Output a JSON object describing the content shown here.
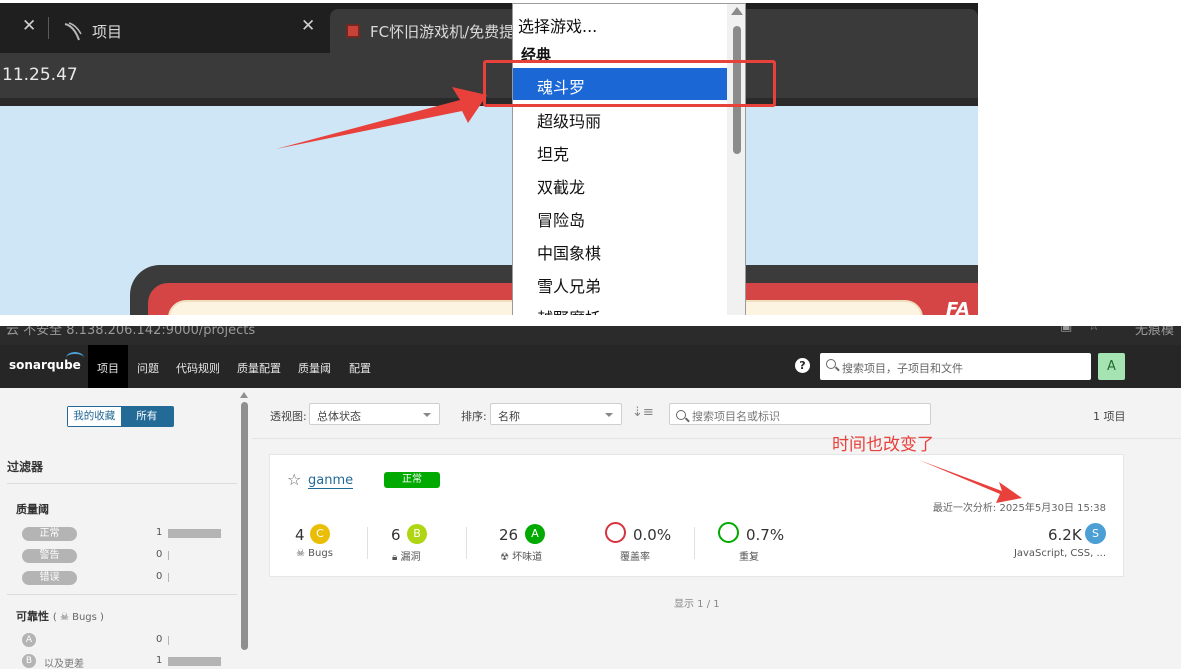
{
  "top": {
    "tabs": [
      {
        "title": "项目"
      },
      {
        "title": "FC怀旧游戏机/免费提供"
      }
    ],
    "address_text": "11.25.47",
    "dropdown": {
      "placeholder": "选择游戏...",
      "group": "经典",
      "selected": "魂斗罗",
      "items": [
        "超级玛丽",
        "坦克",
        "双截龙",
        "冒险岛",
        "中国象棋",
        "雪人兄弟",
        "越野摩托"
      ]
    },
    "game_corner_text": "FA"
  },
  "bottom": {
    "url_text": "云 不安全   8.138.206.142:9000/projects",
    "url_right_text": "无痕模",
    "nav": {
      "logo": "sonarqube",
      "items": [
        "项目",
        "问题",
        "代码规则",
        "质量配置",
        "质量阈",
        "配置"
      ],
      "help": "?",
      "search_placeholder": "搜索项目，子项目和文件",
      "avatar": "A"
    },
    "sidebar": {
      "toggle_fav": "我的收藏",
      "toggle_all": "所有",
      "filter_title": "过滤器",
      "quality_gate": {
        "title": "质量阈",
        "rows": [
          {
            "label": "正常",
            "count": "1",
            "fill": 1.0
          },
          {
            "label": "警告",
            "count": "0",
            "fill": 0
          },
          {
            "label": "错误",
            "count": "0",
            "fill": 0
          }
        ]
      },
      "reliability": {
        "title": "可靠性",
        "subtitle": "Bugs",
        "rows": [
          {
            "badge": "A",
            "label": "",
            "count": "0",
            "fill": 0
          },
          {
            "badge": "B",
            "label": "以及更差",
            "count": "1",
            "fill": 1.0
          }
        ]
      }
    },
    "toolbar": {
      "view_label": "透视图:",
      "view_value": "总体状态",
      "sort_label": "排序:",
      "sort_value": "名称",
      "search_placeholder": "搜索项目名或标识",
      "count": "1 项目"
    },
    "annotation": "时间也改变了",
    "project": {
      "name": "ganme",
      "status": "正常",
      "last_analysis": "最近一次分析: 2025年5月30日 15:38",
      "metrics": {
        "bugs": {
          "value": "4",
          "rating": "C",
          "label": "Bugs"
        },
        "vulns": {
          "value": "6",
          "rating": "B",
          "label": "漏洞"
        },
        "smells": {
          "value": "26",
          "rating": "A",
          "label": "坏味道"
        },
        "coverage": {
          "value": "0.0%",
          "label": "覆盖率"
        },
        "dup": {
          "value": "0.7%",
          "label": "重复"
        },
        "size": {
          "value": "6.2K",
          "badge": "S",
          "languages": "JavaScript, CSS, ..."
        }
      }
    },
    "pager": "显示 1 / 1"
  },
  "colors": {
    "highlight_red": "#e8413c",
    "selected_blue": "#1c67d6",
    "status_green": "#00aa00",
    "rating_A": "#00aa00",
    "rating_B": "#b0d513",
    "rating_C": "#eabe06",
    "coverage_ring": "#d4333f",
    "dup_ring": "#00aa00",
    "sonar_blue": "#236a97"
  }
}
